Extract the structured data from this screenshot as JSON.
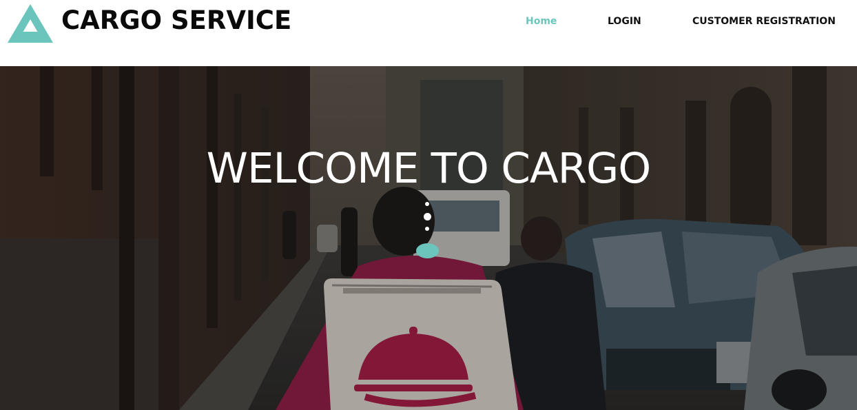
{
  "brand": {
    "name": "CARGO SERVICE",
    "logo_icon": "triangle-logo-icon",
    "accent_color": "#6cc5bc"
  },
  "nav": {
    "items": [
      {
        "label": "Home",
        "active": true
      },
      {
        "label": "LOGIN",
        "active": false
      },
      {
        "label": "CUSTOMER REGISTRATION",
        "active": false
      }
    ]
  },
  "hero": {
    "title": "WELCOME TO CARGO",
    "scroll_indicator_icon": "scroll-down-icon",
    "background": "street-photo-courier-with-delivery-backpack"
  }
}
